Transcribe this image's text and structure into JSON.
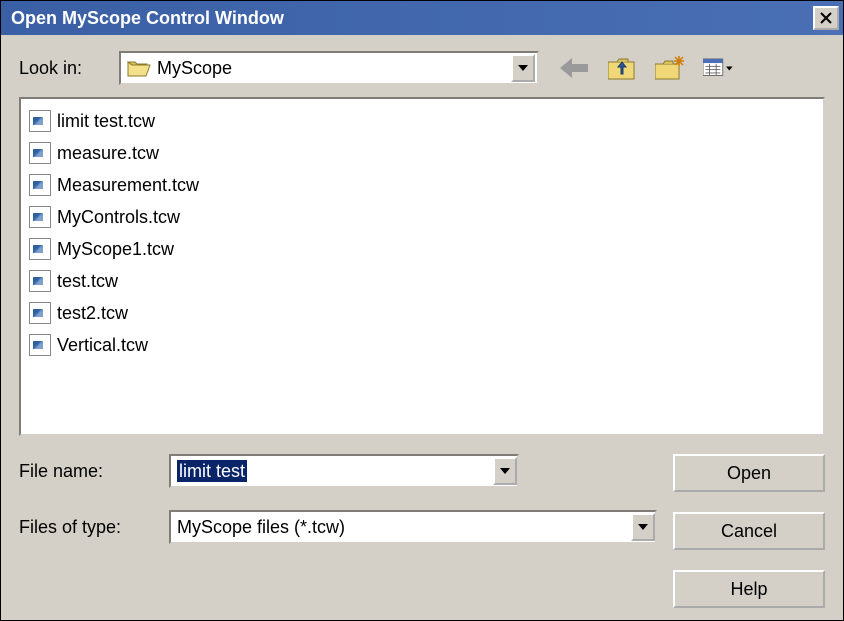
{
  "title": "Open MyScope Control Window",
  "lookin": {
    "label": "Look in:",
    "value": "MyScope"
  },
  "files": [
    "limit test.tcw",
    "measure.tcw",
    "Measurement.tcw",
    "MyControls.tcw",
    "MyScope1.tcw",
    "test.tcw",
    "test2.tcw",
    "Vertical.tcw"
  ],
  "filename": {
    "label": "File name:",
    "value": "limit test"
  },
  "filetype": {
    "label": "Files of type:",
    "value": "MyScope files (*.tcw)"
  },
  "buttons": {
    "open": "Open",
    "cancel": "Cancel",
    "help": "Help"
  },
  "icons": {
    "back": "back-icon",
    "up": "folder-up-icon",
    "new": "new-folder-icon",
    "views": "views-menu-icon"
  }
}
